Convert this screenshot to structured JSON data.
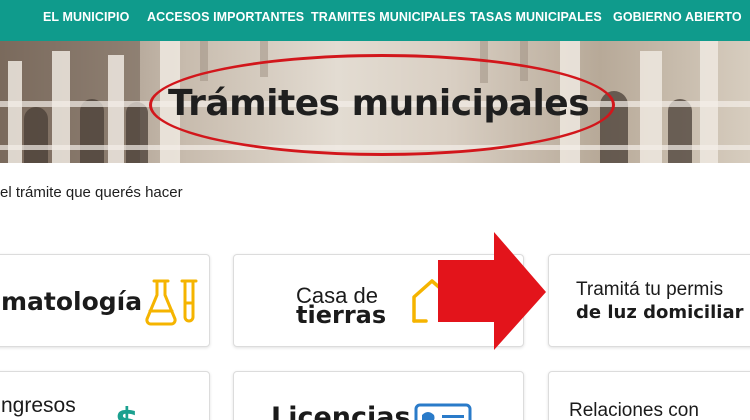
{
  "nav": {
    "items": [
      "EL MUNICIPIO",
      "ACCESOS IMPORTANTES",
      "TRAMITES MUNICIPALES",
      "TASAS MUNICIPALES",
      "GOBIERNO ABIERTO"
    ]
  },
  "hero": {
    "title": "Trámites municipales"
  },
  "intro": "el trámite que querés hacer",
  "cards": {
    "zoonosis": {
      "text": "matología",
      "icon": "test-tubes-icon"
    },
    "tierras": {
      "line1": "Casa de",
      "line2": "tierras",
      "icon": "house-icon"
    },
    "luz": {
      "line1": "Tramitá tu permis",
      "line2": "de luz domiciliar"
    },
    "ingresos": {
      "text": "ngresos",
      "icon": "dollar-icon"
    },
    "licencias": {
      "text": "Licencias",
      "icon": "id-card-icon"
    },
    "relaciones": {
      "text": "Relaciones con"
    }
  },
  "colors": {
    "nav_bg": "#0f9b8c",
    "accent_yellow": "#f5b400",
    "annotation_red": "#e3141b",
    "teal_icon": "#1aa08f"
  }
}
